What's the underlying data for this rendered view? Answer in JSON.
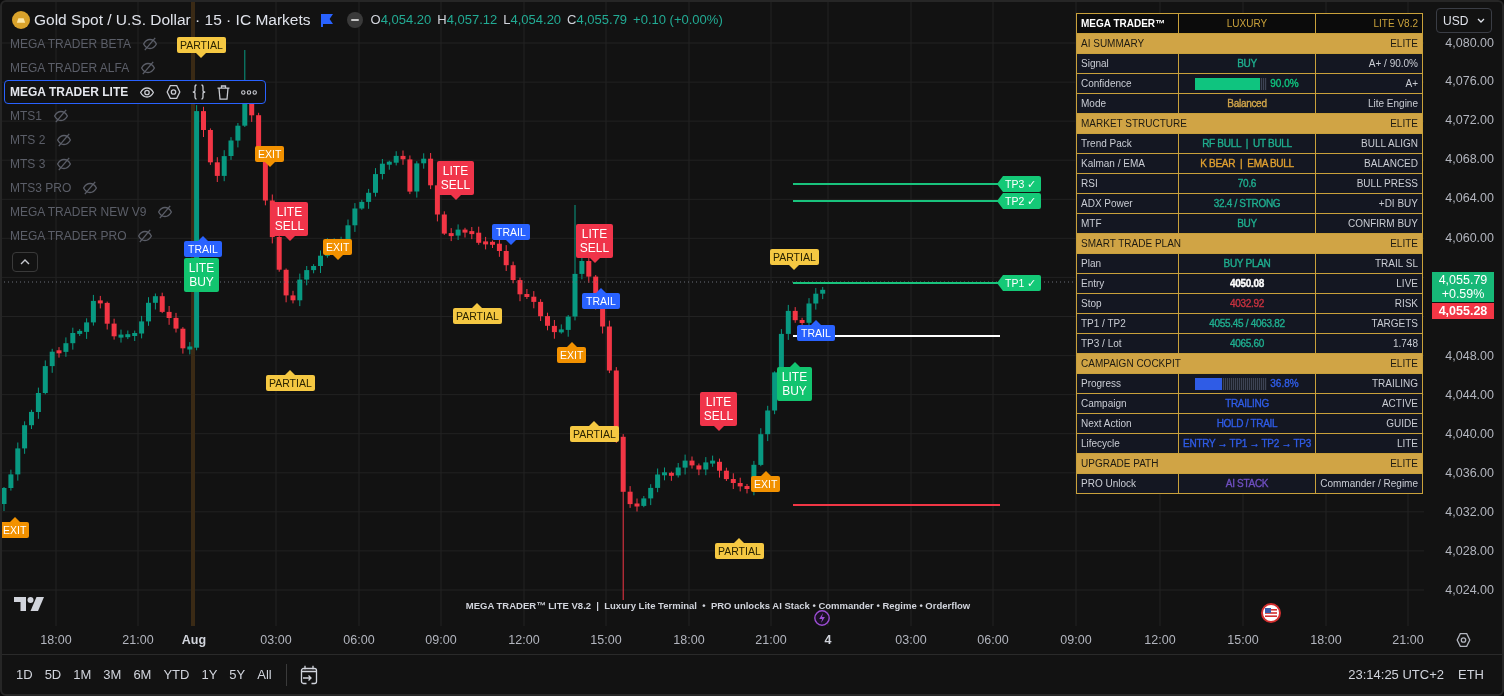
{
  "header": {
    "symbol": "Gold Spot / U.S. Dollar · 15 · IC Markets",
    "ohlc": [
      {
        "key": "O",
        "value": "4,054.20"
      },
      {
        "key": "H",
        "value": "4,057.12"
      },
      {
        "key": "L",
        "value": "4,054.20"
      },
      {
        "key": "C",
        "value": "4,055.79"
      }
    ],
    "change": "+0.10 (+0.00%)"
  },
  "indicators": [
    {
      "name": "MEGA TRADER BETA",
      "visible": false,
      "selected": false
    },
    {
      "name": "MEGA TRADER ALFA",
      "visible": false,
      "selected": false
    },
    {
      "name": "MEGA TRADER LITE",
      "visible": true,
      "selected": true
    },
    {
      "name": "MTS1",
      "visible": false,
      "selected": false
    },
    {
      "name": "MTS 2",
      "visible": false,
      "selected": false
    },
    {
      "name": "MTS 3",
      "visible": false,
      "selected": false
    },
    {
      "name": "MTS3 PRO",
      "visible": false,
      "selected": false
    },
    {
      "name": "MEGA TRADER NEW V9",
      "visible": false,
      "selected": false
    },
    {
      "name": "MEGA TRADER PRO",
      "visible": false,
      "selected": false
    }
  ],
  "signals": [
    {
      "kind": "partial",
      "text": "PARTIAL"
    },
    {
      "kind": "exit",
      "text": "EXIT"
    },
    {
      "kind": "sell",
      "text": "LITE SELL"
    },
    {
      "kind": "trail",
      "text": "TRAIL"
    },
    {
      "kind": "buy",
      "text": "LITE BUY"
    },
    {
      "kind": "exit",
      "text": "EXIT"
    },
    {
      "kind": "sell",
      "text": "LITE SELL"
    },
    {
      "kind": "trail",
      "text": "TRAIL"
    },
    {
      "kind": "partial",
      "text": "PARTIAL"
    },
    {
      "kind": "partial",
      "text": "PARTIAL"
    },
    {
      "kind": "sell",
      "text": "LITE SELL"
    },
    {
      "kind": "trail",
      "text": "TRAIL"
    },
    {
      "kind": "exit",
      "text": "EXIT"
    },
    {
      "kind": "partial",
      "text": "PARTIAL"
    },
    {
      "kind": "sell",
      "text": "LITE SELL"
    },
    {
      "kind": "exit",
      "text": "EXIT"
    },
    {
      "kind": "partial",
      "text": "PARTIAL"
    },
    {
      "kind": "partial",
      "text": "PARTIAL"
    },
    {
      "kind": "trail",
      "text": "TRAIL"
    },
    {
      "kind": "buy",
      "text": "LITE BUY"
    },
    {
      "kind": "exit",
      "text": "EXIT"
    },
    {
      "kind": "target",
      "text": "TP3 ✓"
    },
    {
      "kind": "target",
      "text": "TP2 ✓"
    },
    {
      "kind": "target",
      "text": "TP1 ✓"
    }
  ],
  "panel": {
    "rows": [
      {
        "kind": "title",
        "cells": [
          "MEGA TRADER™",
          "LUXURY",
          "LITE V8.2"
        ]
      },
      {
        "kind": "section",
        "label": "AI SUMMARY",
        "tag": "ELITE"
      },
      {
        "kind": "row",
        "label": "Signal",
        "value": "BUY",
        "color": "#1fae8f",
        "note": "A+ / 90.0%"
      },
      {
        "kind": "meter",
        "label": "Confidence",
        "level": 0.9,
        "value": "90.0%",
        "color": "#0fc47f",
        "note": "A+"
      },
      {
        "kind": "row",
        "label": "Mode",
        "value": "Balanced",
        "color": "#d2a64a",
        "note": "Lite Engine"
      },
      {
        "kind": "section",
        "label": "MARKET STRUCTURE",
        "tag": "ELITE"
      },
      {
        "kind": "row",
        "label": "Trend Pack",
        "value": "RF BULL  |  UT BULL",
        "color": "#1fae8f",
        "note": "BULL ALIGN"
      },
      {
        "kind": "row",
        "label": "Kalman / EMA",
        "value": "K BEAR  |  EMA BULL",
        "color": "#e0a030",
        "note": "BALANCED"
      },
      {
        "kind": "row",
        "label": "RSI",
        "value": "70.6",
        "color": "#1fae8f",
        "note": "BULL PRESS"
      },
      {
        "kind": "row",
        "label": "ADX Power",
        "value": "32.4 / STRONG",
        "color": "#1fae8f",
        "note": "+DI BUY"
      },
      {
        "kind": "row",
        "label": "MTF",
        "value": "BUY",
        "color": "#1fae8f",
        "note": "CONFIRM BUY"
      },
      {
        "kind": "section",
        "label": "SMART TRADE PLAN",
        "tag": "ELITE"
      },
      {
        "kind": "row",
        "label": "Plan",
        "value": "BUY PLAN",
        "color": "#1fae8f",
        "note": "TRAIL SL"
      },
      {
        "kind": "strong",
        "label": "Entry",
        "value": "4050.08",
        "color": "#ffffff",
        "note": "LIVE"
      },
      {
        "kind": "row",
        "label": "Stop",
        "value": "4032.92",
        "color": "#c8323f",
        "note": "RISK"
      },
      {
        "kind": "row",
        "label": "TP1 / TP2",
        "value": "4055.45 / 4063.82",
        "color": "#1fae8f",
        "note": "TARGETS"
      },
      {
        "kind": "row",
        "label": "TP3 / Lot",
        "value": "4065.60",
        "color": "#1fae8f",
        "note": "1.748"
      },
      {
        "kind": "section",
        "label": "CAMPAIGN COCKPIT",
        "tag": "ELITE"
      },
      {
        "kind": "meter",
        "label": "Progress",
        "level": 0.368,
        "value": "36.8%",
        "color": "#2f5ce6",
        "note": "TRAILING"
      },
      {
        "kind": "row",
        "label": "Campaign",
        "value": "TRAILING",
        "color": "#2f5ce6",
        "note": "ACTIVE"
      },
      {
        "kind": "row",
        "label": "Next Action",
        "value": "HOLD / TRAIL",
        "color": "#2f5ce6",
        "note": "GUIDE"
      },
      {
        "kind": "row",
        "label": "Lifecycle",
        "value": "ENTRY → TP1 → TP2 → TP3",
        "color": "#2f5ce6",
        "note": "LITE"
      },
      {
        "kind": "section",
        "label": "UPGRADE PATH",
        "tag": "ELITE"
      },
      {
        "kind": "row",
        "label": "PRO Unlock",
        "value": "AI STACK",
        "color": "#6f4fc0",
        "note": "Commander / Regime"
      }
    ]
  },
  "banner": "MEGA TRADER™ LITE V8.2  |  Luxury Lite Terminal  •  PRO unlocks AI Stack • Commander • Regime • Orderflow",
  "price_axis": {
    "currency": "USD",
    "labels": [
      "4,080.00",
      "4,076.00",
      "4,072.00",
      "4,068.00",
      "4,064.00",
      "4,060.00",
      "4,048.00",
      "4,044.00",
      "4,040.00",
      "4,036.00",
      "4,032.00",
      "4,028.00",
      "4,024.00"
    ],
    "last_price": "4,055.79",
    "last_change": "+0.59%",
    "lower_tag": "4,055.28"
  },
  "time_axis": [
    {
      "text": "18:00",
      "kind": "time"
    },
    {
      "text": "21:00",
      "kind": "time"
    },
    {
      "text": "Aug",
      "kind": "day"
    },
    {
      "text": "03:00",
      "kind": "time"
    },
    {
      "text": "06:00",
      "kind": "time"
    },
    {
      "text": "09:00",
      "kind": "time"
    },
    {
      "text": "12:00",
      "kind": "time"
    },
    {
      "text": "15:00",
      "kind": "time"
    },
    {
      "text": "18:00",
      "kind": "time"
    },
    {
      "text": "21:00",
      "kind": "time"
    },
    {
      "text": "4",
      "kind": "day"
    },
    {
      "text": "03:00",
      "kind": "time"
    },
    {
      "text": "06:00",
      "kind": "time"
    },
    {
      "text": "09:00",
      "kind": "time"
    },
    {
      "text": "12:00",
      "kind": "time"
    },
    {
      "text": "15:00",
      "kind": "time"
    },
    {
      "text": "18:00",
      "kind": "time"
    },
    {
      "text": "21:00",
      "kind": "time"
    }
  ],
  "toolbar": {
    "ranges": [
      "1D",
      "5D",
      "1M",
      "3M",
      "6M",
      "YTD",
      "1Y",
      "5Y",
      "All"
    ],
    "clock": "23:14:25 UTC+2",
    "session": "ETH"
  }
}
